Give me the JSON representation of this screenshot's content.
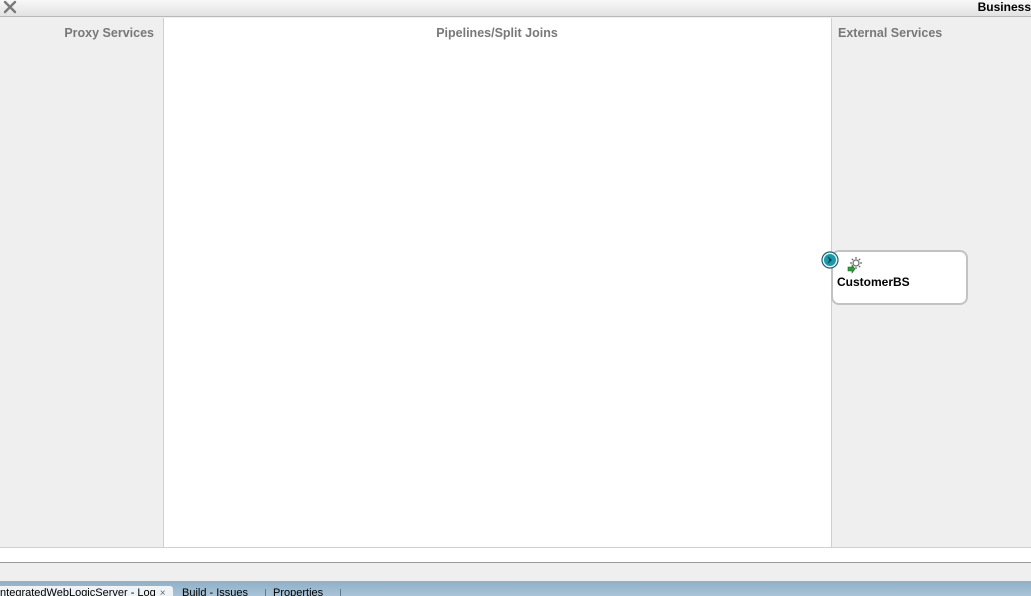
{
  "window": {
    "title": "Business"
  },
  "lanes": {
    "proxy_title": "Proxy Services",
    "pipelines_title": "Pipelines/Split Joins",
    "external_title": "External Services"
  },
  "service": {
    "name": "CustomerBS",
    "icon": "gear-icon",
    "port_icon": "chevron-right-icon"
  },
  "bottom_tabs": [
    {
      "label": "IntegratedWebLogicServer - Log",
      "closable": true
    },
    {
      "label": "Build - Issues",
      "closable": false
    },
    {
      "label": "Properties",
      "closable": false
    }
  ],
  "colors": {
    "lane_bg": "#efefef",
    "canvas_bg": "#ffffff",
    "lane_title": "#787878",
    "port_teal": "#1a9aa8",
    "tab_strip": "#a9c3d6"
  }
}
